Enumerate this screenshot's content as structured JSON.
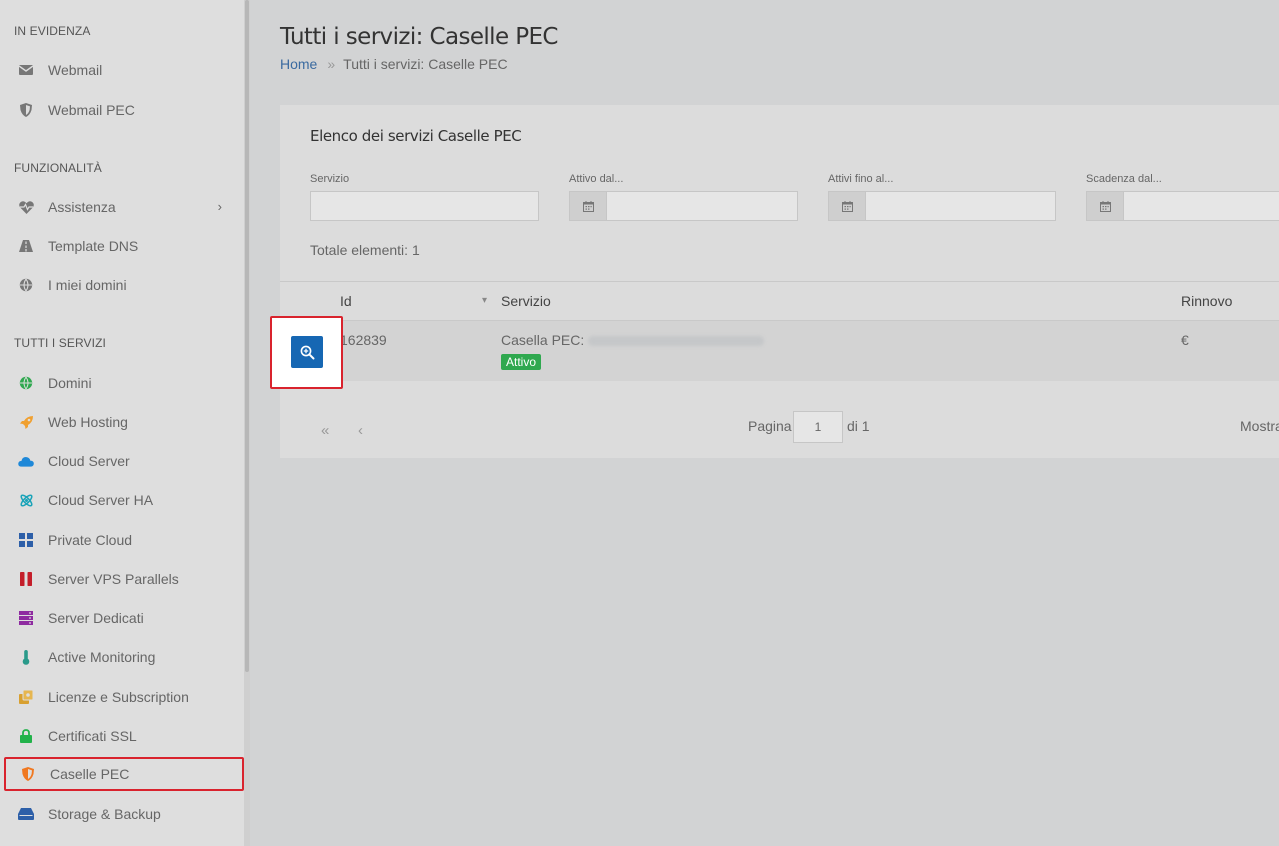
{
  "sidebar": {
    "sections": [
      {
        "title": "IN EVIDENZA"
      },
      {
        "title": "FUNZIONALITÀ"
      },
      {
        "title": "TUTTI I SERVIZI"
      }
    ],
    "items": [
      {
        "label": "Webmail",
        "icon": "envelope-icon"
      },
      {
        "label": "Webmail PEC",
        "icon": "shield-icon"
      },
      {
        "label": "Assistenza",
        "icon": "heartbeat-icon",
        "chevron": "›"
      },
      {
        "label": "Template DNS",
        "icon": "road-icon"
      },
      {
        "label": "I miei domini",
        "icon": "globe-icon"
      },
      {
        "label": "Domini",
        "icon": "globe-icon",
        "color": "#2fa84f"
      },
      {
        "label": "Web Hosting",
        "icon": "rocket-icon",
        "color": "#f0a030"
      },
      {
        "label": "Cloud Server",
        "icon": "cloud-icon",
        "color": "#1e88d8"
      },
      {
        "label": "Cloud Server HA",
        "icon": "atom-icon",
        "color": "#1aa3b8"
      },
      {
        "label": "Private Cloud",
        "icon": "grid-icon",
        "color": "#2d5fa8"
      },
      {
        "label": "Server VPS Parallels",
        "icon": "parallels-icon",
        "color": "#c41e2a"
      },
      {
        "label": "Server Dedicati",
        "icon": "server-icon",
        "color": "#8e2ba0"
      },
      {
        "label": "Active Monitoring",
        "icon": "thermometer-icon",
        "color": "#2a9a8a"
      },
      {
        "label": "Licenze e Subscription",
        "icon": "license-icon",
        "color": "#d8a030"
      },
      {
        "label": "Certificati SSL",
        "icon": "lock-icon",
        "color": "#22b24a"
      },
      {
        "label": "Caselle PEC",
        "icon": "shield-icon",
        "color": "#f07820"
      },
      {
        "label": "Storage & Backup",
        "icon": "hdd-icon",
        "color": "#2d5fa8"
      }
    ]
  },
  "header": {
    "title": "Tutti i servizi: Caselle PEC",
    "breadcrumb": {
      "home": "Home",
      "separator": "»",
      "current": "Tutti i servizi: Caselle PEC"
    }
  },
  "card": {
    "title": "Elenco dei servizi Caselle PEC",
    "filters": [
      {
        "label": "Servizio",
        "value": ""
      },
      {
        "label": "Attivo dal...",
        "value": ""
      },
      {
        "label": "Attivi fino al...",
        "value": ""
      },
      {
        "label": "Scadenza dal...",
        "value": ""
      }
    ],
    "total": "Totale elementi: 1"
  },
  "table": {
    "columns": [
      "Id",
      "Servizio",
      "Rinnovo"
    ],
    "sort_icon": "▾",
    "rows": [
      {
        "id": "162839",
        "service_prefix": "Casella PEC:",
        "status": "Attivo",
        "renewal": "€"
      }
    ]
  },
  "pager": {
    "first": "«",
    "prev": "‹",
    "page_label": "Pagina",
    "page_value": "1",
    "of_label": "di 1",
    "show_label": "Mostra"
  },
  "colors": {
    "primary": "#1667b3",
    "highlight": "#d9232d",
    "active_badge": "#2fa84f"
  }
}
